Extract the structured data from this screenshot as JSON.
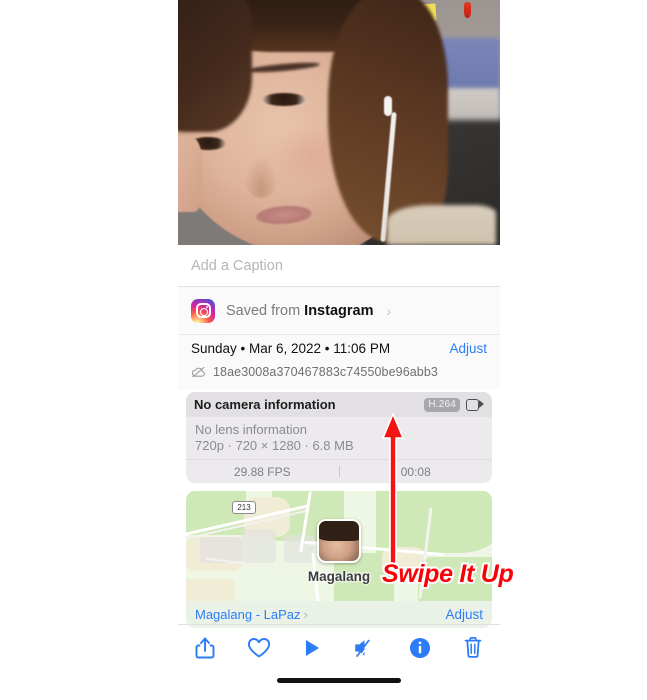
{
  "photo": {
    "alt_description": "selfie-photo"
  },
  "caption": {
    "placeholder": "Add a Caption",
    "value": ""
  },
  "saved_from": {
    "icon": "instagram-icon",
    "prefix": "Saved from ",
    "app": "Instagram",
    "chevron": "›"
  },
  "date": {
    "text": "Sunday • Mar 6, 2022 • 11:06 PM",
    "adjust_label": "Adjust",
    "cloud_icon": "cloud-slash-icon",
    "asset_id": "18ae3008a370467883c74550be96abb3"
  },
  "camera": {
    "title": "No camera information",
    "codec_badge": "H.264",
    "video_icon": "video-camera-icon",
    "lens": "No lens information",
    "specs": "720p · 720 × 1280 · 6.8 MB",
    "fps": "29.88 FPS",
    "duration": "00:08"
  },
  "map": {
    "highway_shield": "213",
    "place_label": "Magalang",
    "avatar": "photo-thumbnail-pin",
    "footer_place": "Magalang - LaPaz",
    "footer_chevron": "›",
    "adjust_label": "Adjust"
  },
  "toolbar": {
    "items": [
      {
        "name": "share-icon",
        "label": "Share"
      },
      {
        "name": "heart-icon",
        "label": "Favorite"
      },
      {
        "name": "play-icon",
        "label": "Play"
      },
      {
        "name": "speaker-slash-icon",
        "label": "Mute"
      },
      {
        "name": "info-icon",
        "label": "Info"
      },
      {
        "name": "trash-icon",
        "label": "Delete"
      }
    ]
  },
  "annotation": {
    "arrow": "up-arrow-annotation",
    "text": "Swipe It Up"
  },
  "colors": {
    "accent_blue": "#2b7cf6",
    "annotation_red": "#fb0007",
    "annotation_outline": "#ffffff",
    "card_gray": "#eceaec",
    "map_green": "#cfe8b7"
  }
}
